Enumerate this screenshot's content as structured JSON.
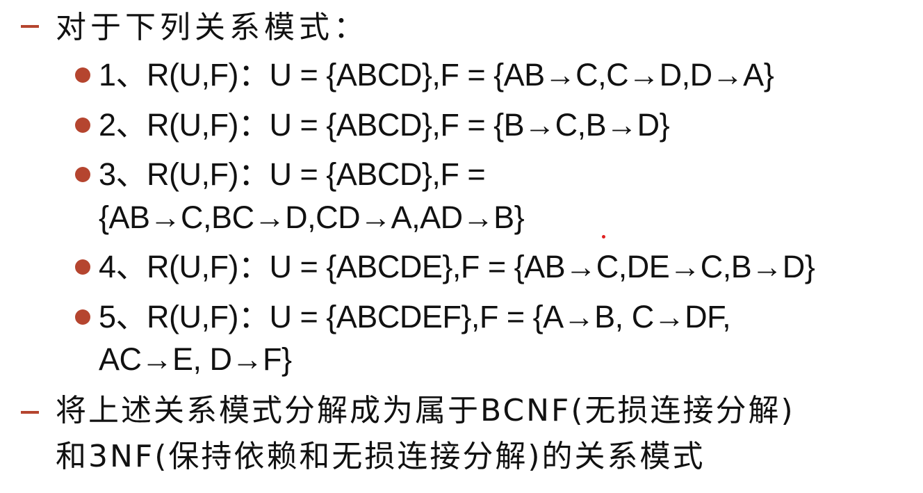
{
  "slide": {
    "heading1": "对于下列关系模式：",
    "items": [
      {
        "line1": "1、R(U,F)：U = {ABCD},F = {AB→C,C→D,D→A}"
      },
      {
        "line1": "2、R(U,F)：U = {ABCD},F = {B→C,B→D}"
      },
      {
        "line1": "3、R(U,F)：U = {ABCD},F =",
        "line2": "{AB→C,BC→D,CD→A,AD→B}"
      },
      {
        "line1": "4、R(U,F)：U = {ABCDE},F = {AB→C,DE→C,B→D}"
      },
      {
        "line1": "5、R(U,F)：U = {ABCDEF},F = {A→B, C→DF,",
        "line2": "AC→E, D→F}"
      }
    ],
    "heading2_line1": "将上述关系模式分解成为属于BCNF(无损连接分解)",
    "heading2_line2": "和3NF(保持依赖和无损连接分解)的关系模式",
    "accent_color": "#b5452f",
    "bullet_shape": "filled-circle"
  }
}
